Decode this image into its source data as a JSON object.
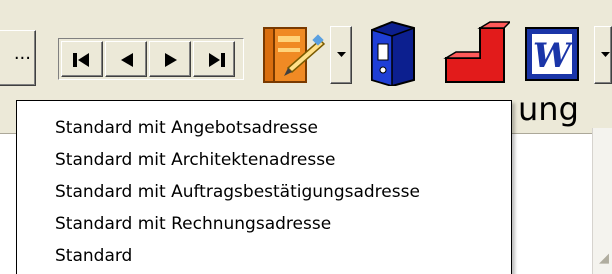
{
  "toolbar": {
    "ellipsis_label": "...",
    "nav": [
      {
        "name": "first-record",
        "icon": "skip-to-first-icon"
      },
      {
        "name": "previous-record",
        "icon": "triangle-left-icon"
      },
      {
        "name": "next-record",
        "icon": "triangle-right-icon"
      },
      {
        "name": "last-record",
        "icon": "skip-to-last-icon"
      }
    ],
    "buttons": [
      {
        "name": "notebook-button",
        "icon": "notebook-pen-icon"
      },
      {
        "name": "binder-button",
        "icon": "blue-binder-icon"
      },
      {
        "name": "red-shape-button",
        "icon": "red-l-shape-icon"
      },
      {
        "name": "word-button",
        "icon": "word-document-icon",
        "letter": "W"
      }
    ]
  },
  "menu": {
    "items": [
      "Standard mit Angebotsadresse",
      "Standard mit Architektenadresse",
      "Standard mit Auftragsbestätigungsadresse",
      "Standard mit Rechnungsadresse",
      "Standard"
    ]
  },
  "background": {
    "partial_label": "ung"
  },
  "colors": {
    "window_bg": "#ece9d8",
    "word_blue": "#1a35a8",
    "binder_blue": "#1f3fd6",
    "red_shape": "#e21b1b",
    "notebook_orange": "#f08a24"
  }
}
